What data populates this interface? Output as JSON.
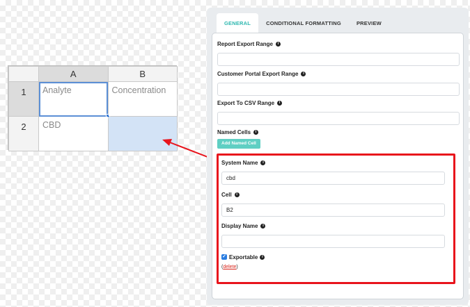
{
  "sheet": {
    "columns": [
      "A",
      "B"
    ],
    "rows": [
      {
        "num": "1",
        "cells": [
          "Analyte",
          "Concentration"
        ]
      },
      {
        "num": "2",
        "cells": [
          "CBD",
          ""
        ]
      }
    ]
  },
  "tabs": [
    {
      "label": "GENERAL",
      "active": true
    },
    {
      "label": "CONDITIONAL FORMATTING",
      "active": false
    },
    {
      "label": "PREVIEW",
      "active": false
    }
  ],
  "general": {
    "report_export_range": {
      "label": "Report Export Range",
      "value": ""
    },
    "customer_portal_export_range": {
      "label": "Customer Portal Export Range",
      "value": ""
    },
    "export_to_csv_range": {
      "label": "Export To CSV Range",
      "value": ""
    },
    "named_cells": {
      "label": "Named Cells",
      "add_button": "Add Named Cell"
    }
  },
  "named_cell": {
    "system_name": {
      "label": "System Name",
      "value": "cbd"
    },
    "cell": {
      "label": "Cell",
      "value": "B2"
    },
    "display_name": {
      "label": "Display Name",
      "value": ""
    },
    "exportable": {
      "label": "Exportable",
      "checked": true
    },
    "delete_label": "delete"
  },
  "colors": {
    "accent": "#2fb8b0",
    "annotation": "#e8141c",
    "highlight": "#d3e3f6"
  },
  "icons": {
    "info": "info-circle-icon",
    "check": "checkbox-checked-icon"
  }
}
